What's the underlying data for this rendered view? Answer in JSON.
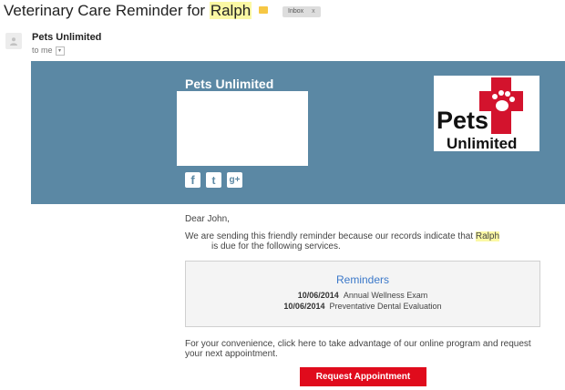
{
  "email": {
    "subject_prefix": "Veterinary Care Reminder for ",
    "subject_pet": "Ralph",
    "label_chip": "Inbox",
    "label_chip_close": "x",
    "sender": "Pets Unlimited",
    "recipient": "to me",
    "recipient_menu": "▾"
  },
  "banner": {
    "brand": "Pets Unlimited",
    "social_icons": [
      "facebook-icon",
      "twitter-icon",
      "google-plus-icon"
    ],
    "social_glyphs": [
      "f",
      "t",
      "g+"
    ],
    "logo_line1": "Pets",
    "logo_line2": "Unlimited",
    "banner_color": "#5b88a4",
    "logo_accent": "#d3132d"
  },
  "body": {
    "greeting": "Dear John,",
    "intro_before": "We are sending this friendly reminder because our records indicate that ",
    "intro_pet": "Ralph",
    "intro_after": "is due for the following services.",
    "reminders_title": "Reminders",
    "reminders": [
      {
        "date": "10/06/2014",
        "service": "Annual Wellness Exam"
      },
      {
        "date": "10/06/2014",
        "service": "Preventative Dental Evaluation"
      }
    ],
    "convenience_line1": "For your convenience, click here to take advantage of our online program and request",
    "convenience_line2": "your next appointment.",
    "cta_label": "Request Appointment",
    "cta_color": "#e00b1c"
  }
}
